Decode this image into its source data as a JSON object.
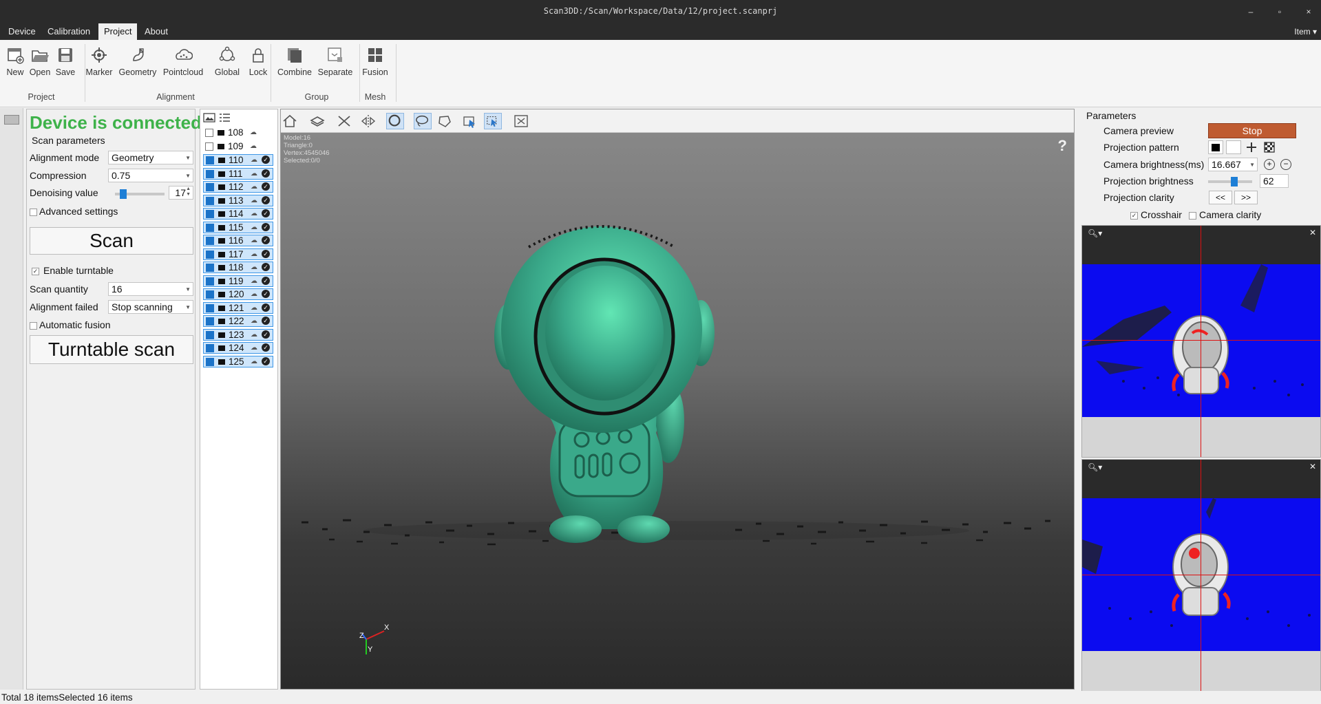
{
  "window": {
    "title": "Scan3DD:/Scan/Workspace/Data/12/project.scanprj",
    "minimize": "–",
    "maximize": "▫",
    "close": "×"
  },
  "menu": {
    "items": [
      "Device",
      "Calibration",
      "Project",
      "About"
    ],
    "active": "Project",
    "right_label": "Item"
  },
  "ribbon": {
    "project": {
      "label": "Project",
      "new": "New",
      "open": "Open",
      "save": "Save"
    },
    "alignment": {
      "label": "Alignment",
      "marker": "Marker",
      "geometry": "Geometry",
      "pointcloud": "Pointcloud",
      "global": "Global",
      "lock": "Lock"
    },
    "group": {
      "label": "Group",
      "combine": "Combine",
      "separate": "Separate"
    },
    "mesh": {
      "label": "Mesh",
      "fusion": "Fusion"
    }
  },
  "scan_panel": {
    "status": "Device is connected",
    "section_title": "Scan parameters",
    "alignment_mode_label": "Alignment mode",
    "alignment_mode_value": "Geometry",
    "compression_label": "Compression",
    "compression_value": "0.75",
    "denoising_label": "Denoising value",
    "denoising_value": "17",
    "denoising_level": 0.12,
    "advanced_settings": "Advanced settings",
    "scan_button": "Scan",
    "enable_turntable": "Enable turntable",
    "enable_turntable_checked": true,
    "scan_quantity_label": "Scan quantity",
    "scan_quantity_value": "16",
    "alignment_failed_label": "Alignment failed",
    "alignment_failed_value": "Stop scanning",
    "automatic_fusion": "Automatic fusion",
    "turntable_button": "Turntable scan"
  },
  "items": [
    {
      "id": "108",
      "selected": false
    },
    {
      "id": "109",
      "selected": false
    },
    {
      "id": "110",
      "selected": true
    },
    {
      "id": "111",
      "selected": true
    },
    {
      "id": "112",
      "selected": true
    },
    {
      "id": "113",
      "selected": true
    },
    {
      "id": "114",
      "selected": true
    },
    {
      "id": "115",
      "selected": true
    },
    {
      "id": "116",
      "selected": true
    },
    {
      "id": "117",
      "selected": true
    },
    {
      "id": "118",
      "selected": true
    },
    {
      "id": "119",
      "selected": true
    },
    {
      "id": "120",
      "selected": true
    },
    {
      "id": "121",
      "selected": true
    },
    {
      "id": "122",
      "selected": true
    },
    {
      "id": "123",
      "selected": true
    },
    {
      "id": "124",
      "selected": true
    },
    {
      "id": "125",
      "selected": true
    }
  ],
  "viewport": {
    "info": [
      "Model:16",
      "Triangle:0",
      "Vertex:4545046",
      "Selected:0/0"
    ],
    "help": "?",
    "axis_x": "X",
    "axis_y": "Y",
    "axis_z": "Z",
    "model_color": "#3aa98a"
  },
  "parameters": {
    "title": "Parameters",
    "camera_preview_label": "Camera preview",
    "stop_button": "Stop",
    "projection_pattern_label": "Projection pattern",
    "camera_brightness_label": "Camera brightness(ms)",
    "camera_brightness_value": "16.667",
    "projection_brightness_label": "Projection brightness",
    "projection_brightness_value": "62",
    "projection_brightness_level": 0.62,
    "projection_clarity_label": "Projection clarity",
    "prev_button": "<<",
    "next_button": ">>",
    "crosshair": "Crosshair",
    "crosshair_checked": true,
    "camera_clarity": "Camera clarity",
    "camera_clarity_checked": false,
    "stop_color": "#bf5b31"
  },
  "status_bar": {
    "text": "Total 18 itemsSelected 16 items"
  }
}
